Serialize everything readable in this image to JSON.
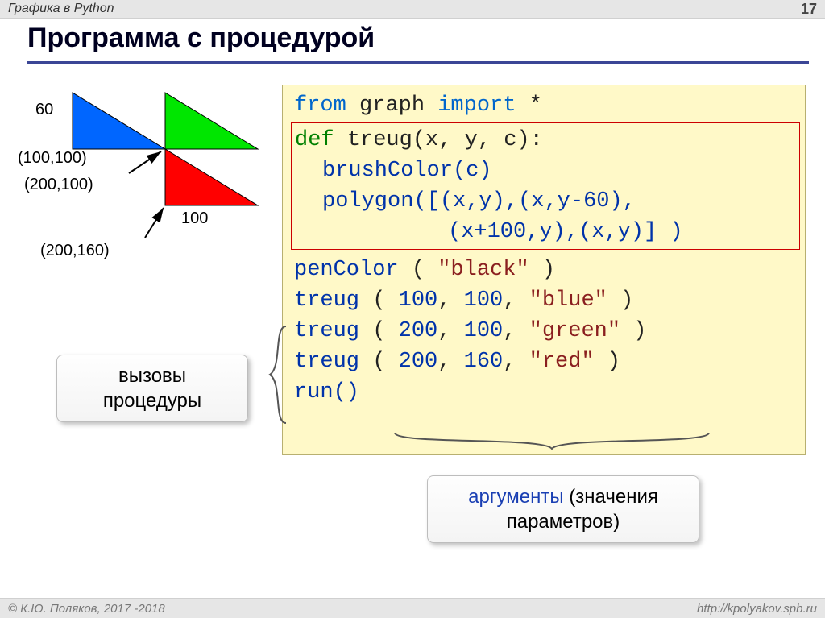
{
  "header": {
    "topic": "Графика в Python",
    "page": "17"
  },
  "title": "Программа с процедурой",
  "footer": {
    "left": "© К.Ю. Поляков, 2017 -2018",
    "right": "http://kpolyakov.spb.ru"
  },
  "diagram": {
    "label60": "60",
    "label100": "100",
    "coord1": "(100,100)",
    "coord2": "(200,100)",
    "coord3": "(200,160)"
  },
  "code": {
    "l1": {
      "from": "from",
      "mod": "graph",
      "import": "import",
      "star": "*"
    },
    "def": {
      "kw": "def",
      "name": "treug",
      "params": "(x, y, c):",
      "b1": "brushColor(c)",
      "b2a": "polygon([(x,y),(x,y-",
      "b2n": "60",
      "b2b": "),",
      "b3a": "(x+",
      "b3n": "100",
      "b3b": ",y),(x,y)] )"
    },
    "pen": {
      "fn": "penColor",
      "open": " ( ",
      "str": "\"black\"",
      "close": " )"
    },
    "call1": {
      "fn": "treug",
      "open": " ( ",
      "a": "100",
      "c1": ", ",
      "b": "100",
      "c2": ", ",
      "s": "\"blue\"",
      "close": " )"
    },
    "call2": {
      "fn": "treug",
      "open": " ( ",
      "a": "200",
      "c1": ", ",
      "b": "100",
      "c2": ", ",
      "s": "\"green\"",
      "close": " )"
    },
    "call3": {
      "fn": "treug",
      "open": " ( ",
      "a": "200",
      "c1": ", ",
      "b": "160",
      "c2": ", ",
      "s": "\"red\"",
      "close": " )"
    },
    "run": "run()"
  },
  "callouts": {
    "left1": "вызовы",
    "left2": "процедуры",
    "bottom_a": "аргументы",
    "bottom_b": " (значения",
    "bottom_c": "параметров)"
  }
}
